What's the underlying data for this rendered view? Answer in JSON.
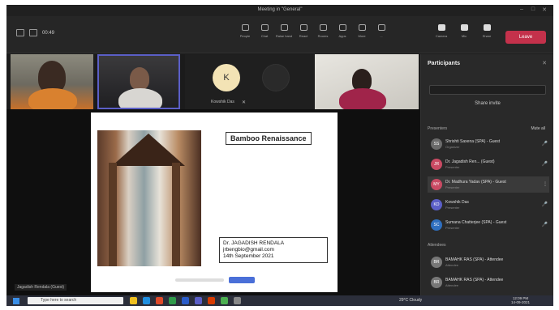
{
  "window": {
    "title": "Meeting in \"General\""
  },
  "toolbar": {
    "time": "00:49",
    "items": [
      {
        "label": "People",
        "icon": "people-icon"
      },
      {
        "label": "Chat",
        "icon": "chat-icon"
      },
      {
        "label": "Raise hand",
        "icon": "hand-icon"
      },
      {
        "label": "React",
        "icon": "react-icon"
      },
      {
        "label": "Rooms",
        "icon": "rooms-icon"
      },
      {
        "label": "Apps",
        "icon": "apps-icon"
      },
      {
        "label": "More",
        "icon": "more-icon"
      },
      {
        "label": "...",
        "icon": "ellipsis-icon"
      }
    ],
    "right_items": [
      {
        "label": "Camera",
        "icon": "camera-icon"
      },
      {
        "label": "Mic",
        "icon": "mic-icon"
      },
      {
        "label": "Share",
        "icon": "share-icon"
      }
    ],
    "leave_label": "Leave"
  },
  "strip": {
    "avatar_letter": "K",
    "tile_name": "Kowshik Das"
  },
  "slide": {
    "title": "Bamboo Renaissance",
    "credit_name": "Dr. JAGADISH RENDALA",
    "credit_email": "jrbengbio@gmail.com",
    "credit_date": "14th September 2021"
  },
  "presenter_tag": "Jagadish Rendala (Guest)",
  "panel": {
    "heading": "Participants",
    "share_invite": "Share invite",
    "section_presenters": "Presenters",
    "section_attendees": "Attendees",
    "mute_all": "Mute all",
    "participants": [
      {
        "name": "Shrishti Saxena (SPA) - Guest",
        "role": "Organizer",
        "color": "#6b6b6b",
        "initials": "SS"
      },
      {
        "name": "Dr. Jagadish Ren... (Guest)",
        "role": "Presenter",
        "color": "#c94a63",
        "initials": "JR"
      },
      {
        "name": "Dr. Madhura Yadav (SPA) - Guest",
        "role": "Presenter",
        "color": "#c94a63",
        "initials": "MY"
      },
      {
        "name": "Kowshik Das",
        "role": "Presenter",
        "color": "#5b5fc7",
        "initials": "KD"
      },
      {
        "name": "Sumana Chatterjee (SPA) - Guest",
        "role": "Presenter",
        "color": "#2f6fbf",
        "initials": "SC"
      }
    ],
    "attendees": [
      {
        "name": "BAMAHK RAS (SPA) - Attendee",
        "role": "Attendee",
        "color": "#777",
        "initials": "BR"
      },
      {
        "name": "BAMAHK RAS (SPA) - Attendee",
        "role": "Attendee",
        "color": "#777",
        "initials": "BR"
      }
    ]
  },
  "taskbar": {
    "search_placeholder": "Type here to search",
    "weather": "29°C Cloudy",
    "time": "12:09 PM",
    "date": "14-09-2021"
  }
}
